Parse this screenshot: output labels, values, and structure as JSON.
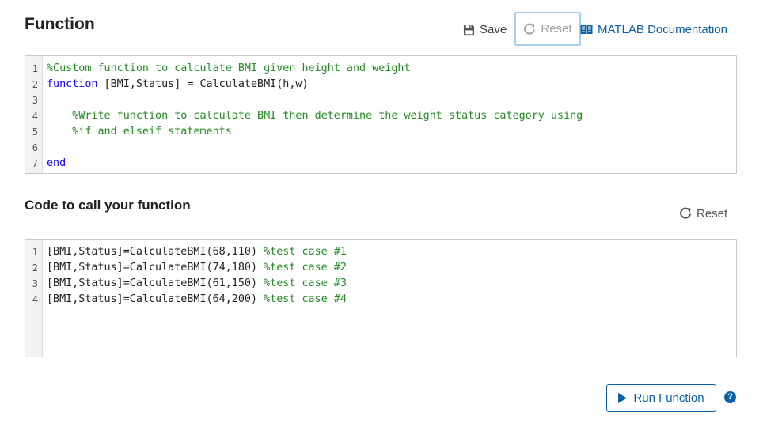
{
  "function_section": {
    "title": "Function",
    "save_label": "Save",
    "reset_label": "Reset",
    "doc_link_label": "MATLAB Documentation",
    "lines": [
      {
        "num": "1",
        "parts": [
          {
            "t": "%Custom function to calculate BMI given height and weight",
            "c": "cm"
          }
        ]
      },
      {
        "num": "2",
        "parts": [
          {
            "t": "function",
            "c": "kw"
          },
          {
            "t": " [BMI,Status] = CalculateBMI(h,w)",
            "c": "tx"
          }
        ]
      },
      {
        "num": "3",
        "parts": []
      },
      {
        "num": "4",
        "parts": [
          {
            "t": "    %Write function to calculate BMI then determine the weight status category using",
            "c": "cm"
          }
        ]
      },
      {
        "num": "5",
        "parts": [
          {
            "t": "    %if and elseif statements",
            "c": "cm"
          }
        ]
      },
      {
        "num": "6",
        "parts": []
      },
      {
        "num": "7",
        "parts": [
          {
            "t": "end",
            "c": "kw"
          }
        ]
      }
    ]
  },
  "call_section": {
    "title": "Code to call your function",
    "reset_label": "Reset",
    "lines": [
      {
        "num": "1",
        "parts": [
          {
            "t": "[BMI,Status]=CalculateBMI(68,110) ",
            "c": "tx"
          },
          {
            "t": "%test case #1",
            "c": "cm"
          }
        ]
      },
      {
        "num": "2",
        "parts": [
          {
            "t": "[BMI,Status]=CalculateBMI(74,180) ",
            "c": "tx"
          },
          {
            "t": "%test case #2",
            "c": "cm"
          }
        ]
      },
      {
        "num": "3",
        "parts": [
          {
            "t": "[BMI,Status]=CalculateBMI(61,150) ",
            "c": "tx"
          },
          {
            "t": "%test case #3",
            "c": "cm"
          }
        ]
      },
      {
        "num": "4",
        "parts": [
          {
            "t": "[BMI,Status]=CalculateBMI(64,200) ",
            "c": "tx"
          },
          {
            "t": "%test case #4",
            "c": "cm"
          }
        ]
      }
    ]
  },
  "run_label": "Run Function",
  "help_glyph": "?",
  "icons": {
    "save": "floppy-disk-icon",
    "reset": "refresh-icon",
    "documentation": "book-icon",
    "run": "play-icon",
    "help": "question-circle-icon"
  },
  "colors": {
    "keyword": "#0e00ff",
    "comment": "#228b22",
    "accent": "#0a5fa8",
    "focus_border": "#a7d0ee"
  }
}
